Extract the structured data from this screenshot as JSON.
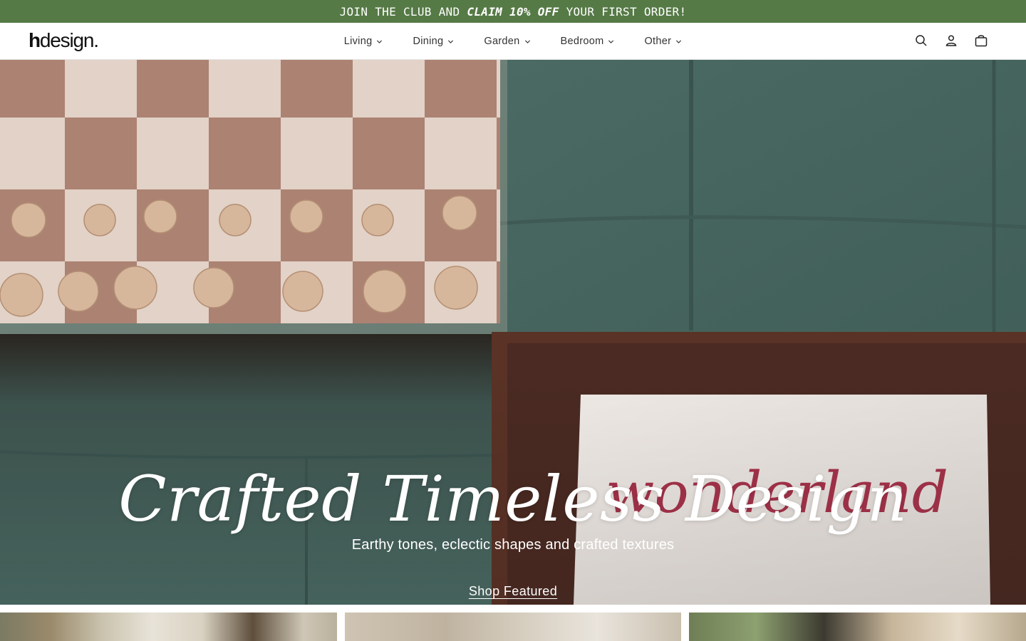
{
  "announcement": {
    "prefix": "JOIN THE CLUB AND",
    "highlight": "CLAIM 10% OFF",
    "suffix": "YOUR FIRST ORDER!"
  },
  "brand": {
    "logo_h": "h",
    "logo_rest": "design."
  },
  "nav": {
    "items": [
      {
        "label": "Living"
      },
      {
        "label": "Dining"
      },
      {
        "label": "Garden"
      },
      {
        "label": "Bedroom"
      },
      {
        "label": "Other"
      }
    ]
  },
  "header_icons": [
    "search-icon",
    "account-icon",
    "cart-icon"
  ],
  "hero": {
    "title": "Crafted Timeless Design",
    "subtitle": "Earthy tones, eclectic shapes and crafted textures",
    "cta_label": "Shop Featured",
    "card_text": "wonderland"
  },
  "colors": {
    "announcement_bg": "#567a46",
    "header_bg": "#ffffff",
    "hero_text": "#ffffff"
  }
}
